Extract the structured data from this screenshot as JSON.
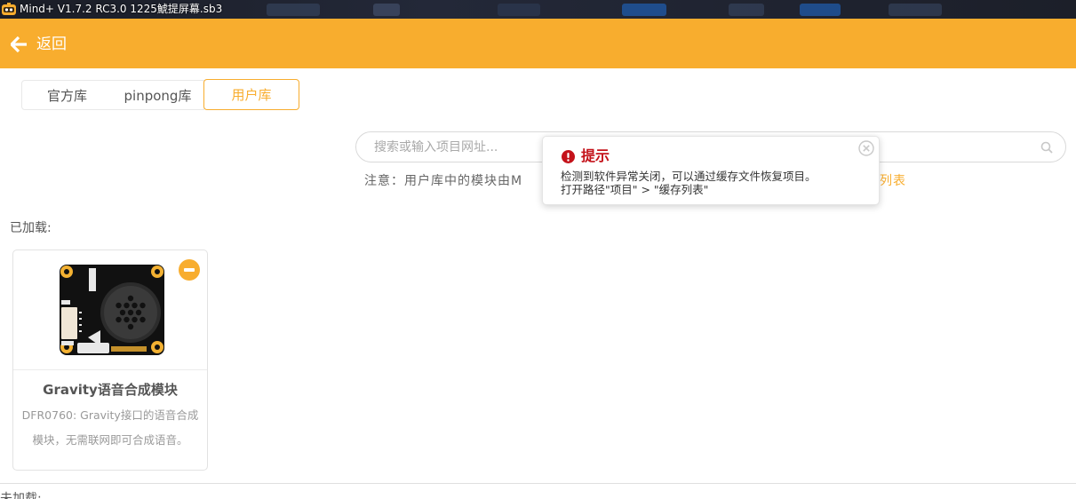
{
  "window": {
    "title": "Mind+ V1.7.2 RC3.0   1225鯱提屏幕.sb3"
  },
  "header": {
    "back_label": "返回",
    "accent_color": "#f8ad2e"
  },
  "tabs": [
    {
      "label": "官方库",
      "active": false
    },
    {
      "label": "pinpong库",
      "active": false
    },
    {
      "label": "用户库",
      "active": true
    }
  ],
  "search": {
    "placeholder": "搜索或输入项目网址...",
    "value": ""
  },
  "notice": {
    "text": "注意：用户库中的模块由M",
    "link_text": "户库列表"
  },
  "loaded": {
    "label": "已加载:"
  },
  "modules": [
    {
      "title": "Gravity语音合成模块",
      "description": "DFR0760: Gravity接口的语音合成模块，无需联网即可合成语音。",
      "image": {
        "board_label": "Speech Synthesis Module V1.0",
        "brand": "Gravity",
        "pins": [
          "D/T",
          "C/R",
          "GND",
          "VCC"
        ],
        "left_labels": [
          "I2C",
          "UART"
        ],
        "bottom_right": "AOP ⊕ AON"
      }
    }
  ],
  "bottom_section": {
    "label": "未加载:"
  },
  "toast": {
    "title": "提示",
    "line1": "检测到软件异常关闭，可以通过缓存文件恢复项目。",
    "line2": "打开路径\"项目\" > \"缓存列表\"",
    "title_color": "#c4121a",
    "icons": [
      "alert-icon",
      "close-icon"
    ]
  }
}
